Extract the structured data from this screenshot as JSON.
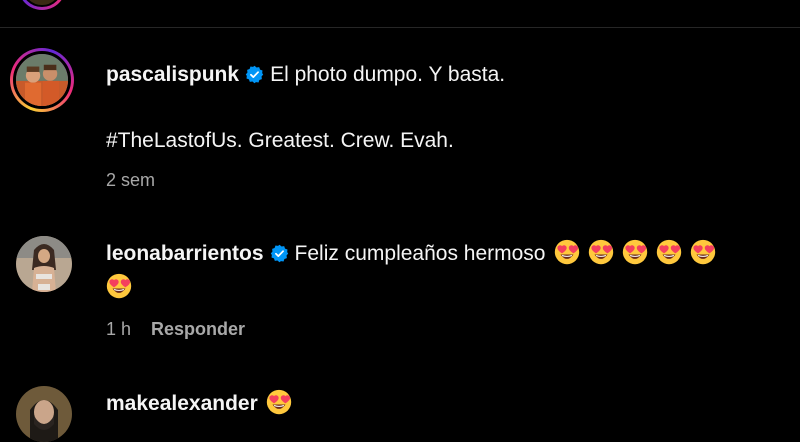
{
  "comments": [
    {
      "username": "pascalispunk",
      "verified": true,
      "text_line1": "El photo dumpo. Y basta.",
      "text_line2": "#TheLastofUs. Greatest. Crew. Evah.",
      "time": "2 sem",
      "avatar_icon": "profile-photo-two-people"
    },
    {
      "username": "leonabarrientos",
      "verified": true,
      "text": "Feliz cumpleaños hermoso",
      "emoji_name": "heart-eyes-emoji",
      "emoji_count": 6,
      "time": "1 h",
      "reply_label": "Responder",
      "avatar_icon": "profile-photo-woman"
    },
    {
      "username": "makealexander",
      "verified": false,
      "emoji_name": "heart-eyes-emoji",
      "emoji_count": 1,
      "avatar_icon": "profile-photo-man"
    }
  ],
  "colors": {
    "background": "#000000",
    "text": "#f5f5f5",
    "muted": "#a8a8a8",
    "verified_badge": "#0095f6"
  }
}
